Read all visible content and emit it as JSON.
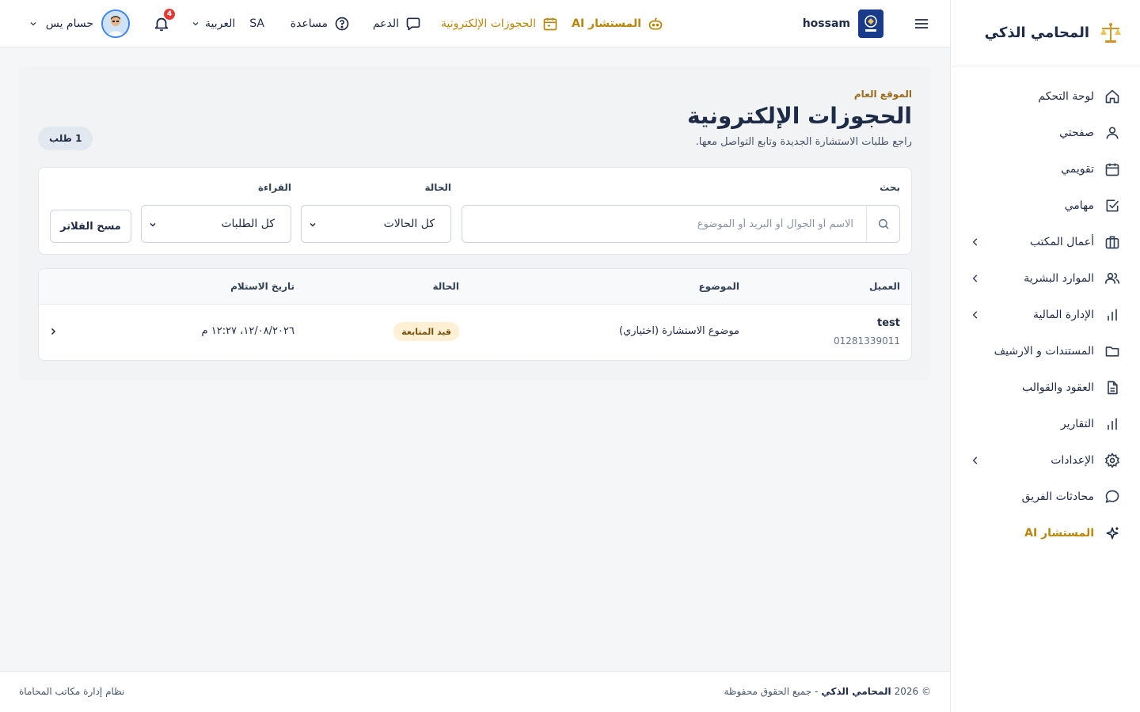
{
  "brand": {
    "name": "المحامي الذكي"
  },
  "topbar": {
    "org_name": "hossam",
    "ai_label": "المستشار AI",
    "bookings_label": "الحجوزات الإلكترونية",
    "support_label": "الدعم",
    "help_label": "مساعدة",
    "language_label": "العربية",
    "language_code": "SA",
    "notifications_count": "4",
    "user_name": "حسام يس"
  },
  "sidebar": {
    "items": [
      {
        "label": "لوحة التحكم",
        "icon": "home-icon"
      },
      {
        "label": "صفحتي",
        "icon": "user-icon"
      },
      {
        "label": "تقويمي",
        "icon": "calendar-icon"
      },
      {
        "label": "مهامي",
        "icon": "checkbox-icon"
      },
      {
        "label": "أعمال المكتب",
        "icon": "briefcase-icon"
      },
      {
        "label": "الموارد البشرية",
        "icon": "users-icon"
      },
      {
        "label": "الإدارة المالية",
        "icon": "bar-chart-icon"
      },
      {
        "label": "المستندات و الارشيف",
        "icon": "folder-icon"
      },
      {
        "label": "العقود والقوالب",
        "icon": "document-icon"
      },
      {
        "label": "التقارير",
        "icon": "bar-chart-icon"
      },
      {
        "label": "الإعدادات",
        "icon": "gear-icon"
      },
      {
        "label": "محادثات الفريق",
        "icon": "chat-icon"
      },
      {
        "label": "المستشار AI",
        "icon": "sparkle-icon"
      }
    ]
  },
  "page": {
    "breadcrumb": "الموقع العام",
    "title": "الحجوزات الإلكترونية",
    "subtitle": "راجع طلبات الاستشارة الجديدة وتابع التواصل معها.",
    "count_badge": "1 طلب"
  },
  "filters": {
    "search_label": "بحث",
    "search_placeholder": "الاسم أو الجوال أو البريد أو الموضوع",
    "status_label": "الحالة",
    "status_value": "كل الحالات",
    "read_label": "القراءة",
    "read_value": "كل الطلبات",
    "clear_label": "مسح الفلاتر"
  },
  "table": {
    "headers": {
      "client": "العميل",
      "subject": "الموضوع",
      "status": "الحالة",
      "received": "تاريخ الاستلام"
    },
    "rows": [
      {
        "client_name": "test",
        "client_phone": "01281339011",
        "subject": "موضوع الاستشارة (اختياري)",
        "status": "قيد المتابعة",
        "received": "١٢/٠٨/٢٠٢٦، ١٢:٢٧ م"
      }
    ]
  },
  "footer": {
    "copyright_prefix": "© 2026",
    "brand": "المحامي الذكي",
    "rights": "- جميع الحقوق محفوظة",
    "system_name": "نظام إدارة مكاتب المحاماة"
  },
  "colors": {
    "accent_gold": "#b8860b",
    "navy": "#1e2b47",
    "badge_bg": "#fdf0d5",
    "notification_red": "#e53935"
  }
}
